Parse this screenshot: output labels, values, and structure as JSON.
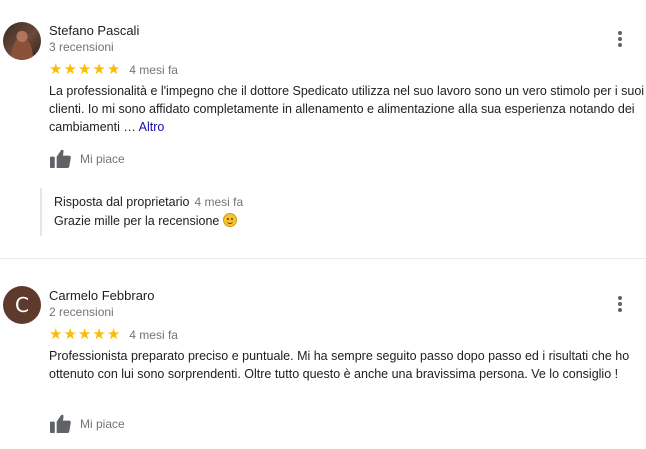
{
  "reviews": [
    {
      "author": "Stefano Pascali",
      "review_count": "3 recensioni",
      "avatar_icon": "profile-photo",
      "rating": 5,
      "stars": [
        "★",
        "★",
        "★",
        "★",
        "★"
      ],
      "time": "4 mesi fa",
      "text": "La professionalità e l'impegno che il dottore Spedicato utilizza nel suo lavoro sono un vero stimolo per i suoi clienti. Io mi sono affidato completamente in allenamento e alimentazione alla sua esperienza notando dei cambiamenti …",
      "more_label": "Altro",
      "like_label": "Mi piace",
      "reply": {
        "owner_label": "Risposta dal proprietario",
        "time": "4 mesi fa",
        "text": "Grazie mille per la recensione"
      }
    },
    {
      "author": "Carmelo Febbraro",
      "review_count": "2 recensioni",
      "avatar_letter": "C",
      "rating": 5,
      "stars": [
        "★",
        "★",
        "★",
        "★",
        "★"
      ],
      "time": "4 mesi fa",
      "text": "Professionista preparato preciso e puntuale. Mi ha sempre seguito passo dopo passo ed i risultati che ho ottenuto con lui sono sorprendenti. Oltre tutto questo è anche una bravissima persona. Ve lo consiglio !",
      "like_label": "Mi piace"
    }
  ],
  "colors": {
    "star": "#fbbc04",
    "link": "#1a0dab",
    "avatar_c_bg": "#5e3a2d",
    "secondary_text": "#70757a"
  },
  "icons": [
    "more-vert-icon",
    "thumbs-up-icon",
    "star-icon",
    "smiley-emoji"
  ]
}
